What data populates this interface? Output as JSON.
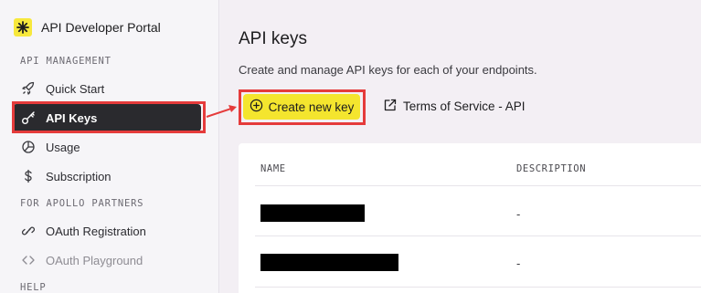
{
  "brand": {
    "title": "API Developer Portal"
  },
  "sidebar": {
    "sections": [
      {
        "label": "API MANAGEMENT"
      },
      {
        "label": "FOR APOLLO PARTNERS"
      },
      {
        "label": "HELP"
      }
    ],
    "items": [
      {
        "label": "Quick Start",
        "icon": "rocket-icon"
      },
      {
        "label": "API Keys",
        "icon": "key-icon",
        "active": true
      },
      {
        "label": "Usage",
        "icon": "pie-chart-icon"
      },
      {
        "label": "Subscription",
        "icon": "dollar-icon"
      },
      {
        "label": "OAuth Registration",
        "icon": "link-icon"
      },
      {
        "label": "OAuth Playground",
        "icon": "code-brackets-icon",
        "muted": true
      }
    ]
  },
  "main": {
    "title": "API keys",
    "description": "Create and manage API keys for each of your endpoints.",
    "create_button": "Create new key",
    "tos_link": "Terms of Service - API"
  },
  "table": {
    "columns": [
      "NAME",
      "DESCRIPTION"
    ],
    "rows": [
      {
        "name": "",
        "description": "-"
      },
      {
        "name": "",
        "description": "-"
      }
    ]
  },
  "colors": {
    "accent_yellow": "#f4e52e",
    "active_nav": "#2a2a2e",
    "annotation_red": "#e53b3b"
  }
}
